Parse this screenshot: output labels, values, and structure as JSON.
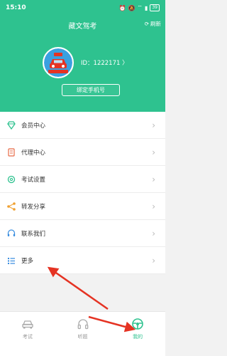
{
  "status": {
    "time": "15:10",
    "battery": "39"
  },
  "header": {
    "title": "藏文驾考",
    "refresh_label": "刷新",
    "user_id": "ID：1222171 〉",
    "bind_button": "绑定手机号"
  },
  "menu": {
    "items": [
      {
        "label": "会员中心",
        "icon": "diamond-icon"
      },
      {
        "label": "代理中心",
        "icon": "agent-icon"
      },
      {
        "label": "考试设置",
        "icon": "settings-icon"
      },
      {
        "label": "转发分享",
        "icon": "share-icon"
      },
      {
        "label": "联系我们",
        "icon": "headset-icon"
      },
      {
        "label": "更多",
        "icon": "list-icon"
      }
    ]
  },
  "tabs": [
    {
      "label": "考试",
      "icon": "car-icon"
    },
    {
      "label": "听题",
      "icon": "headphones-icon"
    },
    {
      "label": "我的",
      "icon": "steering-wheel-icon"
    }
  ],
  "colors": {
    "brand": "#2ec28f",
    "arrow": "#e53323"
  }
}
